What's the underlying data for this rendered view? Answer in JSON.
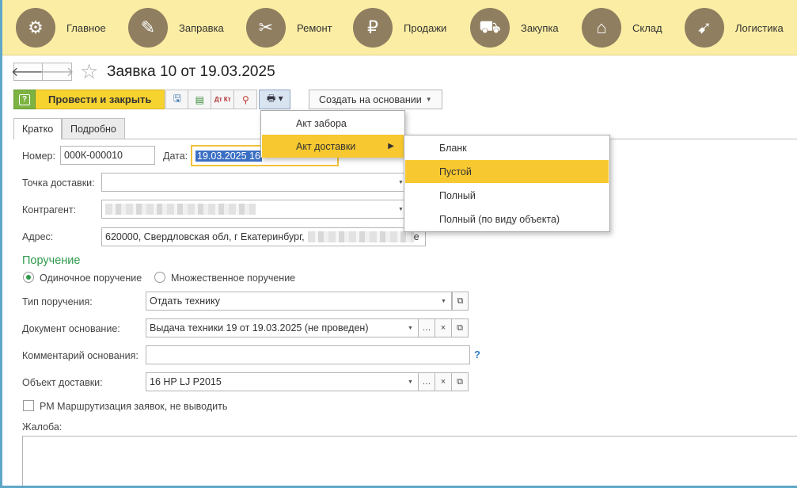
{
  "sections": [
    {
      "label": "Главное",
      "icon": "gears-icon",
      "glyph": "⚙"
    },
    {
      "label": "Заправка",
      "icon": "printer-refill-icon",
      "glyph": "✎"
    },
    {
      "label": "Ремонт",
      "icon": "tools-icon",
      "glyph": "✂"
    },
    {
      "label": "Продажи",
      "icon": "sale-icon",
      "glyph": "₽"
    },
    {
      "label": "Закупка",
      "icon": "cart-icon",
      "glyph": "⛟"
    },
    {
      "label": "Склад",
      "icon": "warehouse-icon",
      "glyph": "⌂"
    },
    {
      "label": "Логистика",
      "icon": "route-icon",
      "glyph": "➹"
    }
  ],
  "colors": {
    "accent_yellow": "#f7d330",
    "highlight": "#f7c830",
    "green": "#2e9a4b",
    "topbar": "#fbeda3"
  },
  "nav": {
    "back": "🡐",
    "forward": "🡒"
  },
  "title": "Заявка 10 от 19.03.2025",
  "toolbar": {
    "help": "?",
    "post_close": "Провести и закрыть",
    "save_glyph": "🖫",
    "dtkt": "Дт Кт",
    "print_glyph": "🖶 ▾",
    "create_based": "Создать на основании"
  },
  "tabs": [
    "Кратко",
    "Подробно"
  ],
  "form": {
    "number_label": "Номер:",
    "number_value": "000К-000010",
    "date_label": "Дата:",
    "date_value": "19.03.2025 16",
    "delivery_point_label": "Точка доставки:",
    "delivery_point_value": "",
    "counterparty_label": "Контрагент:",
    "address_label": "Адрес:",
    "address_value": "620000, Свердловская обл, г Екатеринбург,",
    "address_tail": "е"
  },
  "assignment": {
    "title": "Поручение",
    "single": "Одиночное поручение",
    "multiple": "Множественное поручение",
    "type_label": "Тип поручения:",
    "type_value": "Отдать технику",
    "base_doc_label": "Документ основание:",
    "base_doc_value": "Выдача техники 19 от 19.03.2025 (не проведен)",
    "comment_label": "Комментарий основания:",
    "comment_help": "?",
    "object_label": "Объект доставки:",
    "object_value": "16 HP LJ P2015",
    "routing_checkbox": "РМ Маршрутизация заявок, не выводить",
    "complaint_label": "Жалоба:"
  },
  "menu": {
    "items": [
      "Акт забора",
      "Акт доставки"
    ],
    "submenu": [
      "Бланк",
      "Пустой",
      "Полный",
      "Полный (по виду объекта)"
    ]
  }
}
